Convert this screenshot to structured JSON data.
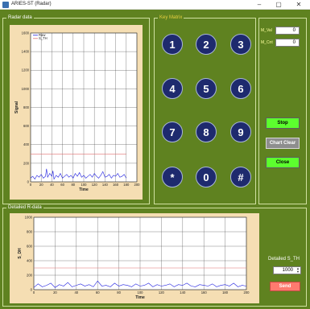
{
  "window": {
    "title": "ARIES-ST (Radar)",
    "minimize_glyph": "–",
    "maximize_glyph": "▢",
    "close_glyph": "✕"
  },
  "radar_group": {
    "title": "Radar data"
  },
  "keypad_group": {
    "title": "Key Matrix",
    "keys": [
      "1",
      "2",
      "3",
      "4",
      "5",
      "6",
      "7",
      "8",
      "9",
      "*",
      "0",
      "#"
    ]
  },
  "control_group": {
    "m_val_label": "M_Val",
    "m_val": "0",
    "m_cnt_label": "M_Cnt",
    "m_cnt": "0",
    "stop_label": "Stop",
    "chart_clear_label": "Chart Clear",
    "close_label": "Close"
  },
  "detailed_group": {
    "title": "Detailed R-data"
  },
  "threshold": {
    "label": "Detailed S_TH",
    "value": "1000",
    "send_label": "Send"
  },
  "colors": {
    "series_raw": "#2020e0",
    "series_threshold": "#e07070",
    "panel_bg": "#f5deb3",
    "app_bg": "#5f8220"
  },
  "chart_data": [
    {
      "type": "line",
      "xlabel": "Time",
      "ylabel": "Signal",
      "xlim": [
        0,
        200
      ],
      "ylim": [
        0,
        1600
      ],
      "xticks": [
        "0",
        "20",
        "40",
        "60",
        "80",
        "100",
        "120",
        "140",
        "160",
        "180",
        "200"
      ],
      "yticks": [
        "0",
        "200",
        "400",
        "600",
        "800",
        "1000",
        "1200",
        "1400",
        "1600"
      ],
      "legend": [
        "Raw",
        "S_TH"
      ],
      "legend_position": "top-left",
      "grid": true,
      "series": [
        {
          "name": "Raw",
          "color": "#2020e0",
          "x": [
            0,
            4,
            8,
            12,
            16,
            20,
            24,
            28,
            30,
            32,
            36,
            40,
            42,
            44,
            48,
            52,
            56,
            60,
            64,
            68,
            72,
            76,
            80,
            84,
            88,
            92,
            96,
            100,
            104,
            108,
            112,
            116,
            120,
            124,
            128,
            132,
            136,
            140,
            144,
            148,
            152,
            156,
            160,
            164,
            168,
            172,
            176,
            180
          ],
          "values": [
            40,
            60,
            30,
            70,
            50,
            80,
            40,
            60,
            140,
            50,
            90,
            60,
            120,
            30,
            70,
            50,
            90,
            40,
            60,
            80,
            50,
            70,
            40,
            90,
            60,
            100,
            50,
            70,
            40,
            60,
            80,
            50,
            90,
            60,
            40,
            70,
            110,
            50,
            60,
            80,
            40,
            70,
            60,
            90,
            50,
            60,
            80,
            40
          ]
        },
        {
          "name": "S_TH",
          "color": "#e07070",
          "x": [
            0,
            180
          ],
          "values": [
            300,
            300
          ]
        }
      ]
    },
    {
      "type": "line",
      "xlabel": "Time",
      "ylabel": "S_DH",
      "xlim": [
        0,
        200
      ],
      "ylim": [
        0,
        1000
      ],
      "xticks": [
        "0",
        "20",
        "40",
        "60",
        "80",
        "100",
        "120",
        "140",
        "160",
        "180",
        "200"
      ],
      "yticks": [
        "0",
        "200",
        "400",
        "600",
        "800",
        "1000"
      ],
      "grid": true,
      "series": [
        {
          "color": "#2020e0",
          "x": [
            0,
            4,
            8,
            12,
            16,
            20,
            24,
            28,
            32,
            36,
            40,
            44,
            48,
            52,
            56,
            60,
            64,
            68,
            72,
            76,
            80,
            84,
            88,
            92,
            96,
            100,
            104,
            108,
            112,
            116,
            120,
            124,
            128,
            132,
            136,
            140,
            144,
            148,
            152,
            156,
            160,
            164,
            168,
            172,
            176,
            180,
            184,
            188,
            192,
            196,
            200
          ],
          "values": [
            30,
            80,
            40,
            60,
            90,
            30,
            70,
            50,
            100,
            40,
            60,
            80,
            50,
            70,
            40,
            120,
            50,
            60,
            40,
            90,
            50,
            70,
            60,
            40,
            80,
            50,
            60,
            90,
            40,
            70,
            50,
            60,
            80,
            40,
            70,
            60,
            90,
            50,
            40,
            70,
            60,
            50,
            80,
            40,
            60,
            70,
            50,
            90,
            40,
            60,
            50
          ]
        },
        {
          "color": "#e07070",
          "x": [
            0,
            200
          ],
          "values": [
            300,
            300
          ]
        }
      ]
    }
  ]
}
